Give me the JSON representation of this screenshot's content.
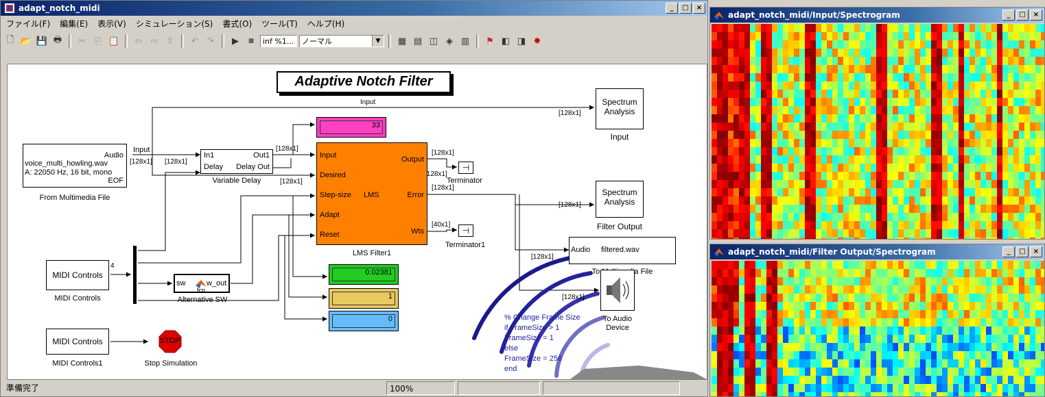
{
  "main_window": {
    "title": "adapt_notch_midi",
    "menu": [
      "ファイル(F)",
      "編集(E)",
      "表示(V)",
      "シミュレーション(S)",
      "書式(O)",
      "ツール(T)",
      "ヘルプ(H)"
    ],
    "toolbar": {
      "stop_time": "inf %1...",
      "sim_mode": "ノーマル"
    },
    "status": {
      "left": "準備完了",
      "zoom": "100%"
    }
  },
  "model": {
    "title": "Adaptive Notch Filter",
    "from_file": {
      "line1": "Audio",
      "line2": "voice_multi_howling.wav",
      "line3": "A: 22050 Hz, 16 bit, mono",
      "eof": "EOF",
      "port_out": "Input",
      "name": "From Multimedia File"
    },
    "variable_delay": {
      "in1": "In1",
      "delay": "Delay",
      "out1": "Out1",
      "delay_out": "Delay Out",
      "name": "Variable Delay"
    },
    "lms": {
      "input": "Input",
      "desired": "Desired",
      "step": "Step-size",
      "adapt": "Adapt",
      "reset": "Reset",
      "center": "LMS",
      "output": "Output",
      "error": "Error",
      "wts": "Wts",
      "name": "LMS Filter1"
    },
    "display_top": "33",
    "display_green": "0.02381",
    "display_yellow": "1",
    "display_blue": "0",
    "spectrum_input": {
      "line1": "Spectrum",
      "line2": "Analysis",
      "name": "Input"
    },
    "spectrum_output": {
      "line1": "Spectrum",
      "line2": "Analysis",
      "name": "Filter Output"
    },
    "terminator": "Terminator",
    "terminator1": "Terminator1",
    "to_file": {
      "port": "Audio",
      "text": "filtered.wav",
      "name": "To Multimedia File"
    },
    "to_audio": {
      "name1": "To Audio",
      "name2": "Device"
    },
    "midi1": {
      "text": "MIDI Controls",
      "name": "MIDI Controls",
      "port": "4"
    },
    "midi2": {
      "text": "MIDI Controls",
      "name": "MIDI Controls1"
    },
    "fcn": {
      "in": "sw",
      "out": "w_out",
      "inner": "fcn",
      "name": "Alternative SW"
    },
    "stop": {
      "text": "STOP",
      "name": "Stop Simulation"
    },
    "signal_labels": {
      "input_line": "Input",
      "dim128": "[128x1]",
      "dim40": "[40x1]"
    },
    "annotation": [
      "% Change Frame Size",
      "if FrameSize > 1",
      "FrameSize = 1",
      "else",
      "FrameSize = 256",
      "end"
    ]
  },
  "spectro_input": {
    "title": "adapt_notch_midi/Input/Spectrogram"
  },
  "spectro_output": {
    "title": "adapt_notch_midi/Filter Output/Spectrogram"
  },
  "colors": {
    "lms": "#ff8000",
    "display_top": "#ff40c0",
    "display_green": "#22cc22",
    "display_yellow": "#e8c860",
    "display_blue": "#66bbff",
    "stop": "#dd0000"
  }
}
